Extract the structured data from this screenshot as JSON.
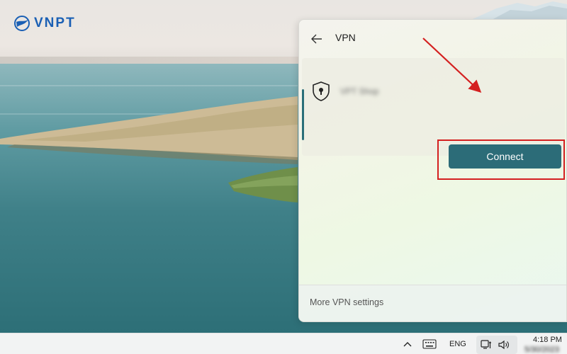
{
  "logo": {
    "text": "VNPT",
    "color": "#1a5fb4"
  },
  "flyout": {
    "title": "VPN",
    "back_icon": "arrow-left-icon",
    "vpn_item": {
      "name": "VPT Shop",
      "icon": "shield-lock-icon",
      "connect_label": "Connect"
    },
    "footer_link": "More VPN settings"
  },
  "annotation": {
    "color": "#d42020"
  },
  "taskbar": {
    "overflow_icon": "chevron-up-icon",
    "keyboard_icon": "keyboard-icon",
    "language": "ENG",
    "network_icon": "network-icon",
    "volume_icon": "volume-icon",
    "time": "4:18 PM",
    "date": "5/30/2023"
  },
  "colors": {
    "accent": "#2c6c78"
  }
}
